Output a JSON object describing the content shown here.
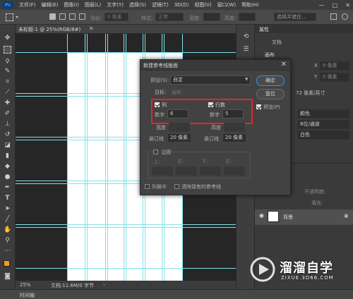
{
  "menubar": {
    "logo": "Ps",
    "items": [
      "文件(F)",
      "编辑(E)",
      "图像(I)",
      "图层(L)",
      "文字(Y)",
      "选择(S)",
      "滤镜(T)",
      "3D(D)",
      "视图(V)",
      "窗口(W)",
      "帮助(H)"
    ],
    "win_buttons": [
      "—",
      "□",
      "✕"
    ]
  },
  "optionsbar": {
    "feather_label": "羽化:",
    "feather_value": "0 像素",
    "style_label": "样式:",
    "style_value": "正常",
    "width_label": "宽度:",
    "height_label": "高度:",
    "select_mask": "选择并遮住..."
  },
  "document": {
    "tab_title": "未标题-1 @ 25%(RGB/8#)",
    "tab_close": "✕",
    "zoom": "25%",
    "doc_info": "文档:11.6M/0 字节"
  },
  "timeline": {
    "label": "时间轴"
  },
  "properties_panel": {
    "title": "属性",
    "doc_label": "文档",
    "canvas_section": "画布",
    "w_label": "W",
    "h_label": "H",
    "x_label": "X",
    "y_label": "Y",
    "x_value": "0 像素",
    "y_value": "0 像素",
    "resolution": "72 像素/英寸",
    "color_mode": "颜色",
    "bit_depth": "8位/通道",
    "fill": "白色",
    "opacity_label": "不透明度:",
    "fill_label": "填充:",
    "background_layer": "背景"
  },
  "dialog": {
    "title": "新建参考线版面",
    "close": "✕",
    "preset_label": "预设(S):",
    "preset_value": "自定",
    "target_label": "目标:",
    "target_value": "画布",
    "ok": "确定",
    "reset": "复位",
    "preview_label": "预览(P)",
    "preview_checked": true,
    "columns": {
      "label": "列",
      "checked": true,
      "number_label": "数字",
      "number_value": "6",
      "width_label": "宽度",
      "gutter_label": "装订线",
      "gutter_value": "20 像素"
    },
    "rows": {
      "label": "行数",
      "checked": true,
      "number_label": "数字",
      "number_value": "5",
      "height_label": "高度",
      "gutter_label": "装订线",
      "gutter_value": "20 像素"
    },
    "margin": {
      "label": "边距",
      "checked": false,
      "top": "上:",
      "left": "左:",
      "bottom": "下:",
      "right": "右:"
    },
    "center_columns": "列居中",
    "clear_existing": "清除现有的参考线"
  },
  "watermark": {
    "title": "溜溜自学",
    "url": "ZIXUE.3D66.COM"
  },
  "colors": {
    "highlight": "#e8242a",
    "guide": "#7fe3ec",
    "fg_swatch": "#f39b1a"
  }
}
